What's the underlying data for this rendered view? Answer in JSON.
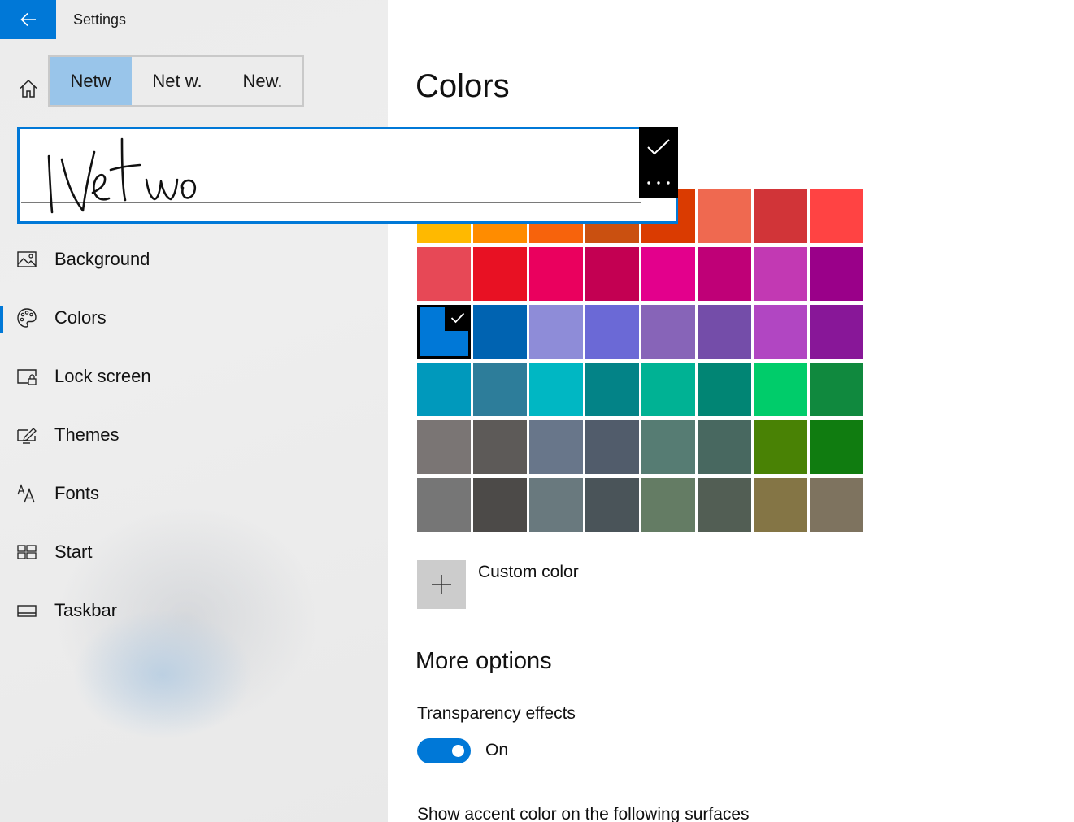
{
  "window": {
    "title": "Settings"
  },
  "candidates": [
    "Netw",
    "Net w.",
    "New."
  ],
  "nav": [
    {
      "label": "Background",
      "icon": "picture-icon"
    },
    {
      "label": "Colors",
      "icon": "palette-icon",
      "active": true
    },
    {
      "label": "Lock screen",
      "icon": "lock-screen-icon"
    },
    {
      "label": "Themes",
      "icon": "themes-icon"
    },
    {
      "label": "Fonts",
      "icon": "fonts-icon"
    },
    {
      "label": "Start",
      "icon": "start-icon"
    },
    {
      "label": "Taskbar",
      "icon": "taskbar-icon"
    }
  ],
  "main": {
    "title": "Colors",
    "custom_color_label": "Custom color",
    "more_options_heading": "More options",
    "transparency_label": "Transparency effects",
    "transparency_state": "On",
    "accent_surfaces_label": "Show accent color on the following surfaces"
  },
  "swatches": [
    [
      "#FFB900",
      "#FF8C00",
      "#F7630C",
      "#CA5010",
      "#DA3B01",
      "#EF6950",
      "#D13438",
      "#FF4343"
    ],
    [
      "#E74856",
      "#E81123",
      "#EA005E",
      "#C30052",
      "#E3008C",
      "#BF0077",
      "#C239B3",
      "#9A0089"
    ],
    [
      "#0078D7",
      "#0063B1",
      "#8E8CD8",
      "#6B69D6",
      "#8764B8",
      "#744DA9",
      "#B146C2",
      "#881798"
    ],
    [
      "#0099BC",
      "#2D7D9A",
      "#00B7C3",
      "#038387",
      "#00B294",
      "#018574",
      "#00CC6A",
      "#10893E"
    ],
    [
      "#7A7574",
      "#5D5A58",
      "#68768A",
      "#515C6B",
      "#567C73",
      "#486860",
      "#498205",
      "#107C10"
    ],
    [
      "#767676",
      "#4C4A48",
      "#69797E",
      "#4A5459",
      "#647C64",
      "#525E54",
      "#847545",
      "#7E735F"
    ]
  ],
  "selected_swatch": "#0078D7",
  "colors": {
    "accent": "#0078d7",
    "candidate_highlight": "#99c5ea"
  },
  "icons": {
    "back": "back-arrow-icon",
    "home": "home-icon",
    "commit": "checkmark-icon",
    "more": "more-dots-icon",
    "custom": "plus-icon"
  }
}
